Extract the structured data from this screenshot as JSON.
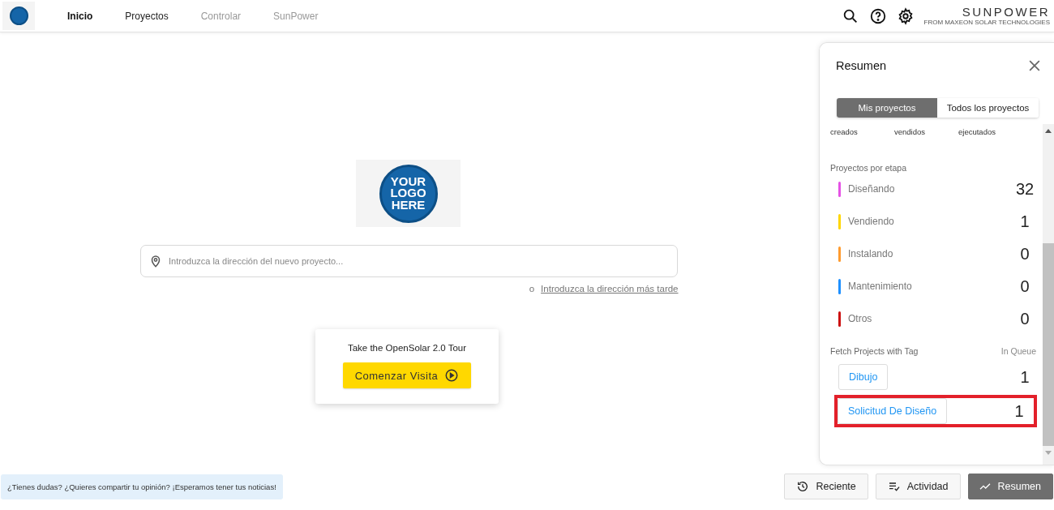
{
  "header": {
    "nav": [
      {
        "label": "Inicio",
        "selected": true,
        "disabled": false
      },
      {
        "label": "Proyectos",
        "selected": false,
        "disabled": false
      },
      {
        "label": "Controlar",
        "selected": false,
        "disabled": true
      },
      {
        "label": "SunPower",
        "selected": false,
        "disabled": true
      }
    ],
    "brand": {
      "name": "SUNPOWER",
      "tagline": "FROM MAXEON SOLAR TECHNOLOGIES"
    }
  },
  "main": {
    "logo": {
      "lines": [
        "YOUR",
        "LOGO",
        "HERE"
      ]
    },
    "address": {
      "placeholder": "Introduzca la dirección del nuevo proyecto..."
    },
    "later": {
      "prefix": "o",
      "link": "Introduzca la dirección más tarde"
    },
    "tour": {
      "title": "Take the OpenSolar 2.0 Tour",
      "button": "Comenzar Visita"
    }
  },
  "panel": {
    "title": "Resumen",
    "toggle": [
      {
        "label": "Mis proyectos",
        "selected": true
      },
      {
        "label": "Todos los proyectos",
        "selected": false
      }
    ],
    "stats": [
      "creados",
      "vendidos",
      "ejecutados"
    ],
    "stages_title": "Proyectos por etapa",
    "stages": [
      {
        "label": "Diseñando",
        "count": "32",
        "color": "#e552e5"
      },
      {
        "label": "Vendiendo",
        "count": "1",
        "color": "#ffd600"
      },
      {
        "label": "Instalando",
        "count": "0",
        "color": "#ff9b2f"
      },
      {
        "label": "Mantenimiento",
        "count": "0",
        "color": "#1e90ff"
      },
      {
        "label": "Otros",
        "count": "0",
        "color": "#cc1111"
      }
    ],
    "tags_title": "Fetch Projects with Tag",
    "queue_title": "In Queue",
    "tags": [
      {
        "label": "Dibujo",
        "count": "1",
        "highlighted": false
      },
      {
        "label": "Solicitud De Diseño",
        "count": "1",
        "highlighted": true
      }
    ]
  },
  "footer": {
    "feedback": "¿Tienes dudas? ¿Quieres compartir tu opinión? ¡Esperamos tener tus noticias!",
    "buttons": [
      {
        "label": "Reciente",
        "selected": false
      },
      {
        "label": "Actividad",
        "selected": false
      },
      {
        "label": "Resumen",
        "selected": true
      }
    ]
  }
}
